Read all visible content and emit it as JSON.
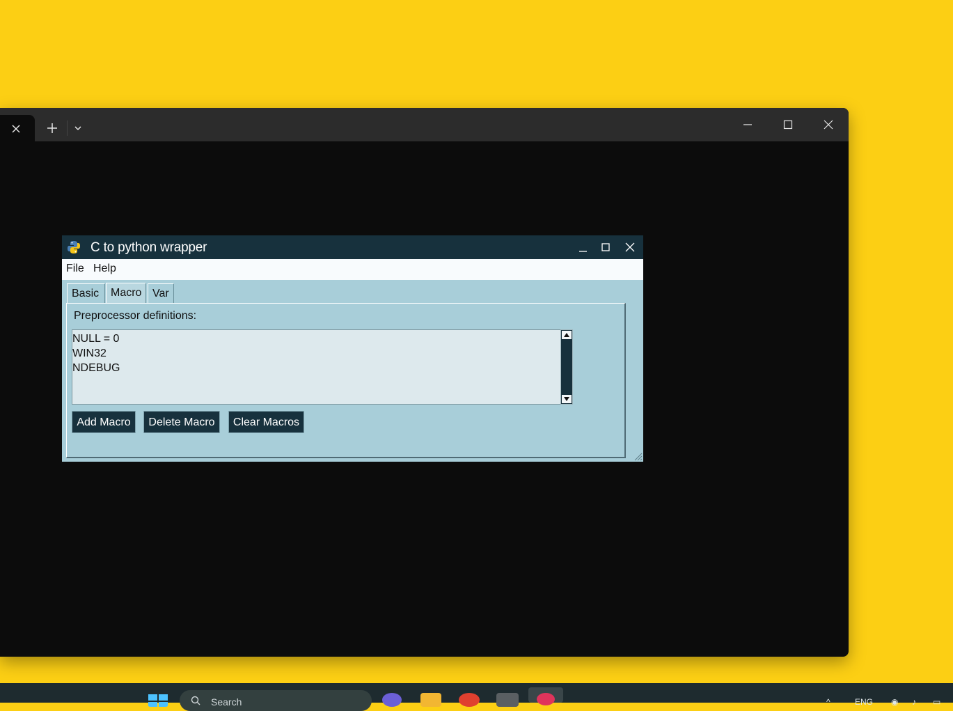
{
  "terminal": {
    "tab_close": "close-icon",
    "new_tab": "plus-icon",
    "dropdown": "chevron-down-icon"
  },
  "app": {
    "title": "C to python wrapper",
    "menu": [
      "File",
      "Help"
    ],
    "tabs": [
      "Basic",
      "Macro",
      "Var"
    ],
    "active_tab": "Macro",
    "panel_label": "Preprocessor definitions:",
    "macros": [
      "NULL = 0",
      "WIN32",
      "NDEBUG"
    ],
    "buttons": {
      "add": "Add Macro",
      "delete": "Delete Macro",
      "clear": "Clear Macros"
    }
  },
  "taskbar": {
    "search_placeholder": "Search",
    "language": "ENG"
  },
  "colors": {
    "desktop": "#fccf14",
    "app_bg": "#a8ced9",
    "app_dark": "#17313d"
  }
}
